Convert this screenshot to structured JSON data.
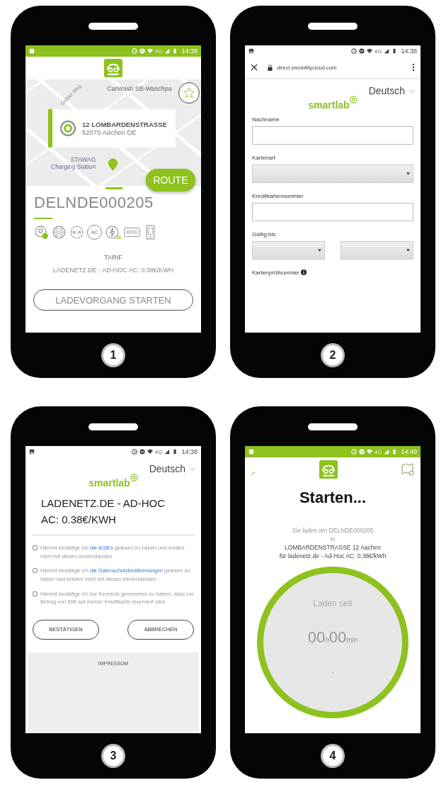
{
  "phones": [
    {
      "number": "1",
      "kind": "station",
      "status_bar": {
        "network": "4G",
        "time": "14:38",
        "tinted": true
      },
      "map": {
        "street": "Grüner Weg",
        "poi": "CarWash SB-Waschpa",
        "station_name": "STAWAG",
        "station_type": "Charging Station"
      },
      "address": {
        "title": "12 LOMBARDENSTRASSE",
        "subtitle": "52070 Aachen DE"
      },
      "route_button": "ROUTE",
      "station_id": "DELNDE000205",
      "features": [
        {
          "kind": "location"
        },
        {
          "kind": "type2"
        },
        {
          "kind": "schuko"
        },
        {
          "kind": "round",
          "label": "AC"
        },
        {
          "kind": "power",
          "label": "11"
        },
        {
          "kind": "card",
          "label": "RFID"
        },
        {
          "kind": "phone"
        }
      ],
      "tariff_label": "TARIF",
      "tariff": "LADENETZ.DE - AD-HOC AC: 0.38€/KWH",
      "start_button": "LADEVORGANG STARTEN"
    },
    {
      "number": "2",
      "kind": "form",
      "status_bar": {
        "network": "4G",
        "time": "14:38",
        "tinted": false
      },
      "url": "direct.emobilitycloud.com",
      "language": "Deutsch",
      "brand": "smartlab",
      "fields": [
        {
          "label": "Nachname",
          "kind": "text"
        },
        {
          "label": "Kartenart",
          "kind": "select"
        },
        {
          "label": "Kreditkartennummer",
          "kind": "text"
        },
        {
          "label": "Gültig bis",
          "kind": "select_pair"
        },
        {
          "label": "Kartenprüfnummer",
          "kind": "info"
        }
      ]
    },
    {
      "number": "3",
      "kind": "consent",
      "status_bar": {
        "network": "4G",
        "time": "14:38",
        "tinted": false
      },
      "language": "Deutsch",
      "brand": "smartlab",
      "tariff": "LADENETZ.DE - AD-HOC AC: 0.38€/KWH",
      "consents": [
        {
          "before": "Hiermit bestätige ich ",
          "link": "die AGB's",
          "after": " gelesen zu haben und erkläre mich mit diesen einverstanden",
          "checked": false
        },
        {
          "before": "Hiermit bestätige ich ",
          "link": "die Datenschutzbestimmungen",
          "after": " gelesen zu haben und erkläre mich mit diesen einverstanden",
          "checked": false
        },
        {
          "before": "Hiermit bestätige ich zur Kenntnis genommen zu haben, dass ein Betrag von 50€ auf meiner Kreditkarte reserviert wird.",
          "checked": false
        }
      ],
      "buttons": [
        "BESTÄTIGEN",
        "ABBRECHEN"
      ],
      "footer": "IMPRESSUM"
    },
    {
      "number": "4",
      "kind": "charging",
      "status_bar": {
        "network": "4G",
        "time": "14:40",
        "tinted": true
      },
      "title": "Starten...",
      "lines": [
        "Sie laden am DELNDE000205",
        "in",
        "LOMBARDENSTRASSE 12 Aachen",
        "für ladenetz.de - Ad-Hoc AC: 0.38€/kWh"
      ],
      "timer_label": "Laden seit",
      "timer": "00$_{h}$00$_{min}$",
      "timer_note": "-"
    }
  ]
}
